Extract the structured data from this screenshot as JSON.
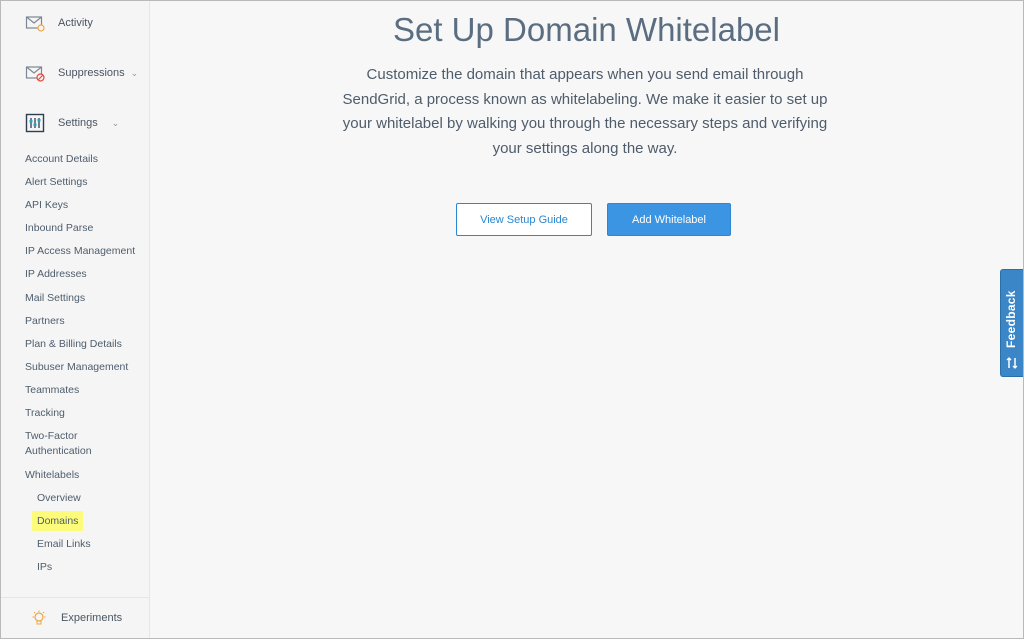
{
  "sidebar": {
    "activity": "Activity",
    "suppressions": "Suppressions",
    "settings": "Settings",
    "settings_items": [
      "Account Details",
      "Alert Settings",
      "API Keys",
      "Inbound Parse",
      "IP Access Management",
      "IP Addresses",
      "Mail Settings",
      "Partners",
      "Plan & Billing Details",
      "Subuser Management",
      "Teammates",
      "Tracking"
    ],
    "two_factor_line1": "Two-Factor",
    "two_factor_line2": "Authentication",
    "whitelabels": "Whitelabels",
    "whitelabel_items": [
      "Overview",
      "Domains",
      "Email Links",
      "IPs"
    ],
    "active_item": "Domains",
    "experiments": "Experiments"
  },
  "main": {
    "title": "Set Up Domain Whitelabel",
    "description": "Customize the domain that appears when you send email through SendGrid, a process known as whitelabeling. We make it easier to set up your whitelabel by walking you through the necessary steps and verifying your settings along the way.",
    "view_guide_button": "View Setup Guide",
    "add_button": "Add Whitelabel"
  },
  "feedback": {
    "label": "Feedback"
  },
  "colors": {
    "primary": "#3c95e3",
    "highlight": "#fdfc7a",
    "text": "#4e5c6b"
  }
}
